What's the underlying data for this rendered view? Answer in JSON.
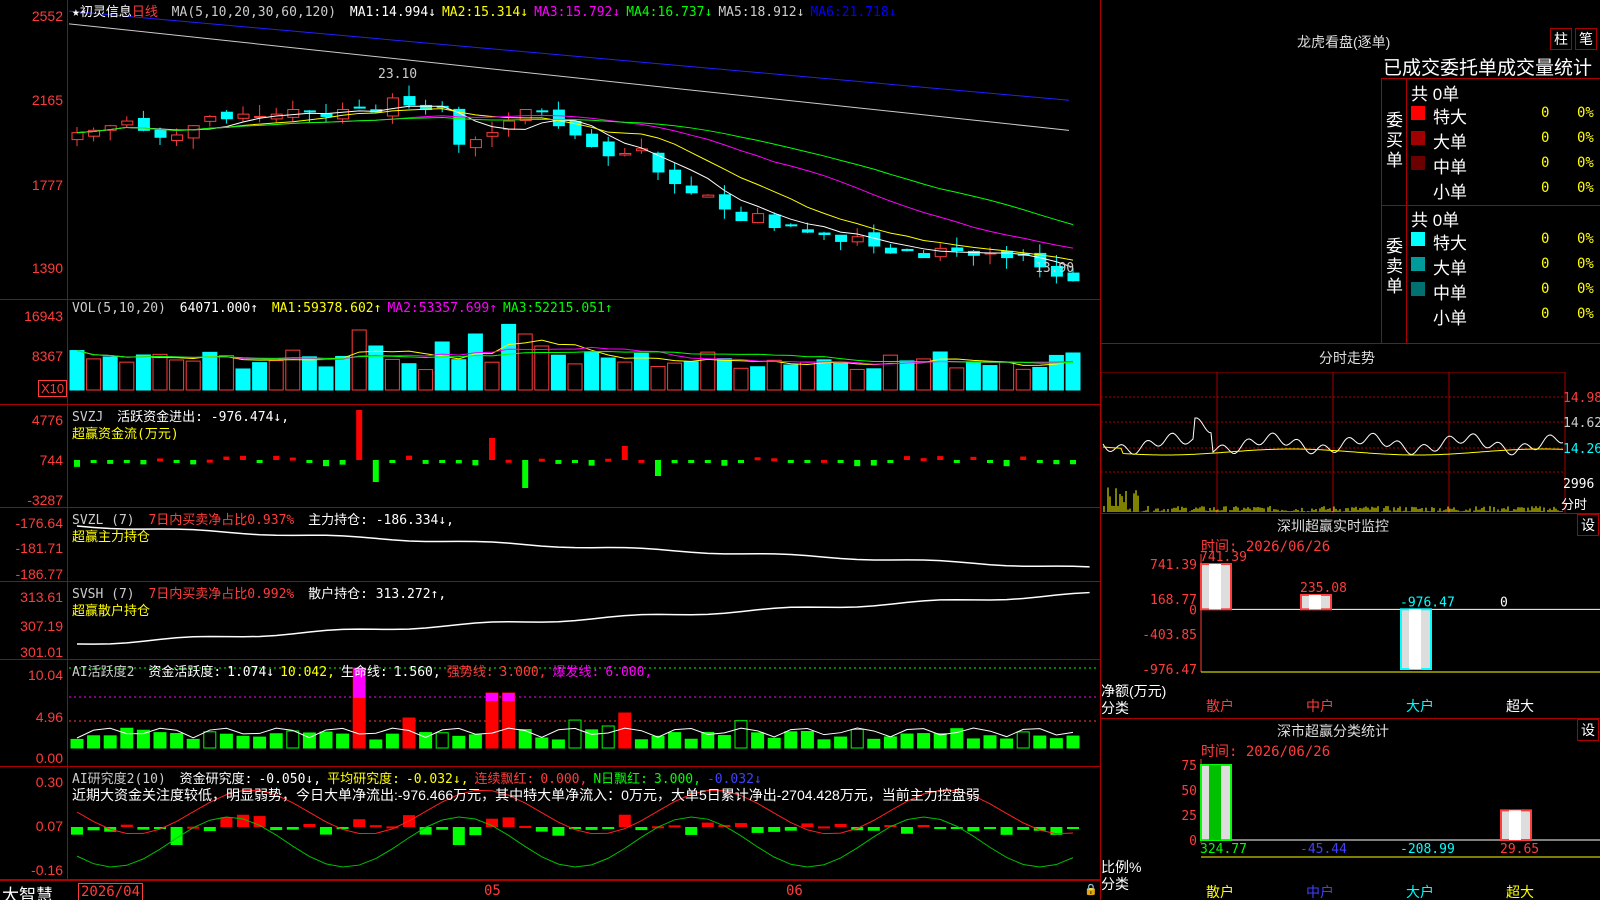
{
  "price": {
    "title": "★初灵信息",
    "period": "日线",
    "ma_label": "MA(5,10,20,30,60,120)",
    "ma": [
      {
        "label": "MA1:",
        "value": "14.994↓",
        "color": "#ffffff"
      },
      {
        "label": "MA2:",
        "value": "15.314↓",
        "color": "#ffff00"
      },
      {
        "label": "MA3:",
        "value": "15.792↓",
        "color": "#ff00ff"
      },
      {
        "label": "MA4:",
        "value": "16.737↓",
        "color": "#00ff00"
      },
      {
        "label": "MA5:",
        "value": "18.912↓",
        "color": "#cccccc"
      },
      {
        "label": "MA6:",
        "value": "21.718↓",
        "color": "#0000ff"
      }
    ],
    "y_labels": [
      "2552",
      "2165",
      "1777",
      "1390"
    ],
    "high_note": "23.10",
    "low_note": "13.90"
  },
  "volume": {
    "title": "VOL(5,10,20)",
    "value": "64071.000↑",
    "ma": [
      {
        "label": "MA1:",
        "value": "59378.602↑",
        "color": "#ffff00"
      },
      {
        "label": "MA2:",
        "value": "53357.699↑",
        "color": "#ff00ff"
      },
      {
        "label": "MA3:",
        "value": "52215.051↑",
        "color": "#00ff00"
      }
    ],
    "y_labels": [
      "16943",
      "8367"
    ],
    "unit": "X10"
  },
  "svzj": {
    "title": "SVZJ",
    "label": "活跃资金进出:",
    "value": "-976.474↓,",
    "sub": "超赢资金流(万元)",
    "y_labels": [
      "4776",
      "744",
      "-3287"
    ]
  },
  "svzl": {
    "title": "SVZL (7)",
    "pct": "7日内买卖净占比0.937%",
    "label": "主力持仓:",
    "value": "-186.334↓,",
    "sub": "超赢主力持仓",
    "y_labels": [
      "-176.64",
      "-181.71",
      "-186.77"
    ]
  },
  "svsh": {
    "title": "SVSH (7)",
    "pct": "7日内买卖净占比0.992%",
    "label": "散户持仓:",
    "value": "313.272↑,",
    "sub": "超赢散户持仓",
    "y_labels": [
      "313.61",
      "307.19",
      "301.01"
    ]
  },
  "ai_active": {
    "title": "AI活跃度2",
    "items": [
      {
        "t": "资金活跃度:",
        "c": "#ffffff"
      },
      {
        "t": "1.074↓",
        "c": "#ffffff"
      },
      {
        "t": "10.042,",
        "c": "#ffff00"
      },
      {
        "t": "生命线:",
        "c": "#ffffff"
      },
      {
        "t": "1.560,",
        "c": "#ffffff"
      },
      {
        "t": "强势线:",
        "c": "#ff3c3c"
      },
      {
        "t": "3.000,",
        "c": "#ff3c3c"
      },
      {
        "t": "爆发线:",
        "c": "#ff00ff"
      },
      {
        "t": "6.000,",
        "c": "#ff00ff"
      }
    ],
    "y_labels": [
      "10.04",
      "4.96",
      "0.00"
    ]
  },
  "ai_research": {
    "title": "AI研究度2(10)",
    "items": [
      {
        "t": "资金研究度:",
        "c": "#ffffff"
      },
      {
        "t": "-0.050↓,",
        "c": "#ffffff"
      },
      {
        "t": "平均研究度:",
        "c": "#ffff00"
      },
      {
        "t": "-0.032↓,",
        "c": "#ffff00"
      },
      {
        "t": "连续飘红:",
        "c": "#ff3c3c"
      },
      {
        "t": "0.000,",
        "c": "#ff3c3c"
      },
      {
        "t": "N日飘红:",
        "c": "#00ff00"
      },
      {
        "t": "3.000,",
        "c": "#00ff00"
      },
      {
        "t": "-0.032↓",
        "c": "#4040ff"
      }
    ],
    "comment": "近期大资金关注度较低，明显弱势，今日大单净流出:-976.466万元，其中特大单净流入：0万元，大单5日累计净出-2704.428万元，当前主力控盘弱",
    "y_labels": [
      "0.30",
      "0.07",
      "-0.16"
    ]
  },
  "footer": {
    "brand": "大智慧",
    "dates": [
      "2026/04",
      "05",
      "06"
    ]
  },
  "dragon": {
    "title": "龙虎看盘(逐单)",
    "btn1": "柱",
    "btn2": "笔",
    "subtitle": "已成交委托单成交量统计",
    "buy": {
      "side": "委买单",
      "total": "共 0单",
      "rows": [
        {
          "name": "特大",
          "v": "0",
          "p": "0%",
          "c": "#ff0000"
        },
        {
          "name": "大单",
          "v": "0",
          "p": "0%",
          "c": "#a00000"
        },
        {
          "name": "中单",
          "v": "0",
          "p": "0%",
          "c": "#6a0000"
        },
        {
          "name": "小单",
          "v": "0",
          "p": "0%",
          "c": "#000000"
        }
      ]
    },
    "sell": {
      "side": "委卖单",
      "total": "共 0单",
      "rows": [
        {
          "name": "特大",
          "v": "0",
          "p": "0%",
          "c": "#00ffff"
        },
        {
          "name": "大单",
          "v": "0",
          "p": "0%",
          "c": "#009a9a"
        },
        {
          "name": "中单",
          "v": "0",
          "p": "0%",
          "c": "#007070"
        },
        {
          "name": "小单",
          "v": "0",
          "p": "0%",
          "c": "#000000"
        }
      ]
    }
  },
  "intraday": {
    "title": "分时走势",
    "y_labels": [
      "14.98",
      "14.62",
      "14.26"
    ],
    "vol_label": "2996",
    "vol_unit": "分时"
  },
  "monitor": {
    "title": "深圳超赢实时监控",
    "btn": "设",
    "time_label": "时间: 2026/06/26",
    "unit": "净额(万元)",
    "cat_label": "分类",
    "y_labels": [
      "741.39",
      "168.77",
      "0",
      "-403.85",
      "-976.47"
    ],
    "chart_data": {
      "type": "bar",
      "categories": [
        "散户",
        "中户",
        "大户",
        "超大"
      ],
      "values": [
        741.39,
        235.08,
        -976.47,
        0
      ]
    }
  },
  "classify": {
    "title": "深市超赢分类统计",
    "btn": "设",
    "time_label": "时间: 2026/06/26",
    "unit": "比例%",
    "cat_label": "分类",
    "y_labels": [
      "75",
      "50",
      "25",
      "0"
    ],
    "chart_data": {
      "type": "bar",
      "categories": [
        "散户",
        "中户",
        "大户",
        "超大"
      ],
      "values": [
        324.77,
        -45.44,
        -208.99,
        29.65
      ]
    }
  },
  "chart_data": [
    {
      "type": "bar",
      "categories": [
        "散户",
        "中户",
        "大户",
        "超大"
      ],
      "values": [
        741.39,
        235.08,
        -976.47,
        0
      ],
      "ylim": [
        -976.47,
        741.39
      ]
    },
    {
      "type": "bar",
      "categories": [
        "散户",
        "中户",
        "大户",
        "超大"
      ],
      "values": [
        324.77,
        -45.44,
        -208.99,
        29.65
      ],
      "ylim": [
        0,
        75
      ]
    }
  ]
}
